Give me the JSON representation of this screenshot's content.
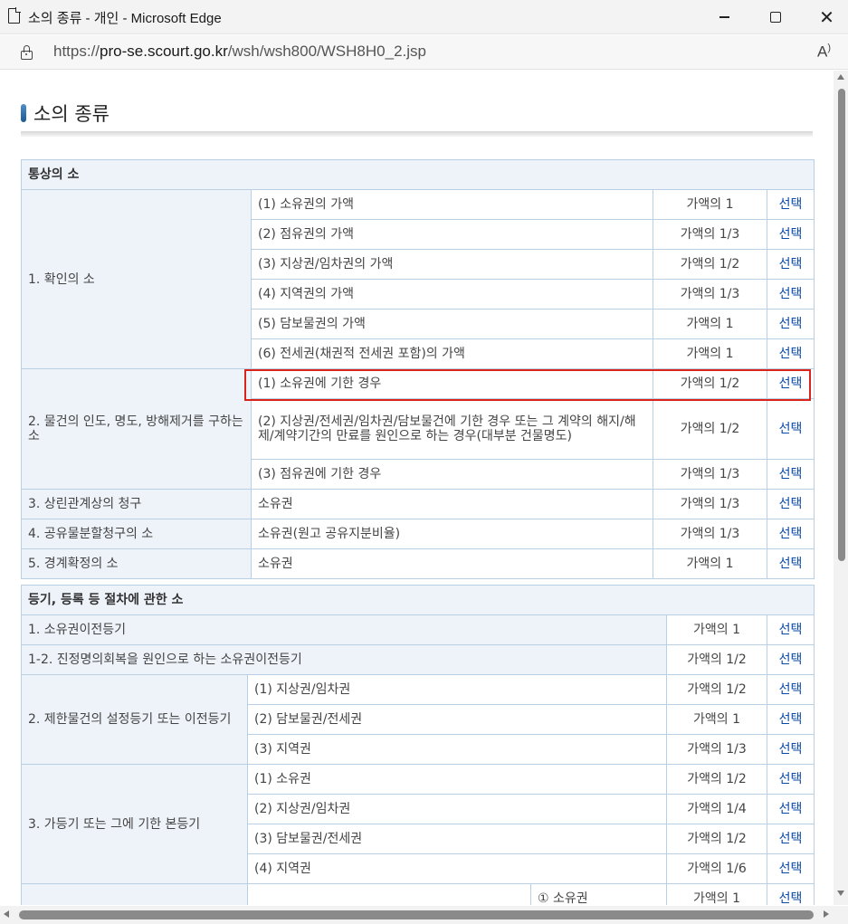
{
  "window": {
    "title": "소의 종류 - 개인 - Microsoft Edge",
    "url_prefix": "https://",
    "url_host": "pro-se.scourt.go.kr",
    "url_path": "/wsh/wsh800/WSH8H0_2.jsp",
    "read_aloud": "A",
    "icons": {
      "doc": "document-icon",
      "minimize": "minimize-icon",
      "maximize": "maximize-icon",
      "close": "close-icon",
      "lock": "lock-icon",
      "read_aloud": "read-aloud-icon"
    }
  },
  "page": {
    "heading": "소의 종류",
    "select_label": "선택",
    "sec1": {
      "title": "통상의 소",
      "g1": {
        "label": "1. 확인의 소",
        "rows": [
          {
            "desc": "(1) 소유권의 가액",
            "amount": "가액의 1"
          },
          {
            "desc": "(2) 점유권의 가액",
            "amount": "가액의 1/3"
          },
          {
            "desc": "(3) 지상권/임차권의 가액",
            "amount": "가액의 1/2"
          },
          {
            "desc": "(4) 지역권의 가액",
            "amount": "가액의 1/3"
          },
          {
            "desc": "(5) 담보물권의 가액",
            "amount": "가액의 1"
          },
          {
            "desc": "(6) 전세권(채권적 전세권 포함)의 가액",
            "amount": "가액의 1"
          }
        ]
      },
      "g2": {
        "label": "2. 물건의 인도, 명도, 방해제거를 구하는 소",
        "rows": [
          {
            "desc": "(1) 소유권에 기한 경우",
            "amount": "가액의 1/2"
          },
          {
            "desc": "(2) 지상권/전세권/임차권/담보물건에 기한 경우 또는 그 계약의 해지/해제/계약기간의 만료를 원인으로 하는 경우(대부분 건물명도)",
            "amount": "가액의 1/2"
          },
          {
            "desc": "(3) 점유권에 기한 경우",
            "amount": "가액의 1/3"
          }
        ]
      },
      "g3": {
        "label": "3. 상린관계상의 청구",
        "desc": "소유권",
        "amount": "가액의 1/3"
      },
      "g4": {
        "label": "4. 공유물분할청구의 소",
        "desc": "소유권(원고 공유지분비율)",
        "amount": "가액의 1/3"
      },
      "g5": {
        "label": "5. 경계확정의 소",
        "desc": "소유권",
        "amount": "가액의 1"
      }
    },
    "sec2": {
      "title": "등기, 등록 등 절차에 관한 소",
      "r1": {
        "label": "1. 소유권이전등기",
        "amount": "가액의 1"
      },
      "r12": {
        "label": "1-2. 진정명의회복을 원인으로 하는 소유권이전등기",
        "amount": "가액의 1/2"
      },
      "g2": {
        "label": "2. 제한물건의 설정등기 또는 이전등기",
        "rows": [
          {
            "desc": "(1) 지상권/임차권",
            "amount": "가액의 1/2"
          },
          {
            "desc": "(2) 담보물권/전세권",
            "amount": "가액의 1"
          },
          {
            "desc": "(3) 지역권",
            "amount": "가액의 1/3"
          }
        ]
      },
      "g3": {
        "label": "3. 가등기 또는 그에 기한 본등기",
        "rows": [
          {
            "desc": "(1) 소유권",
            "amount": "가액의 1/2"
          },
          {
            "desc": "(2) 지상권/임차권",
            "amount": "가액의 1/4"
          },
          {
            "desc": "(3) 담보물권/전세권",
            "amount": "가액의 1/2"
          },
          {
            "desc": "(4) 지역권",
            "amount": "가액의 1/6"
          }
        ]
      },
      "g4": {
        "sub": "① 소유권",
        "amount": "가액의 1"
      }
    }
  }
}
